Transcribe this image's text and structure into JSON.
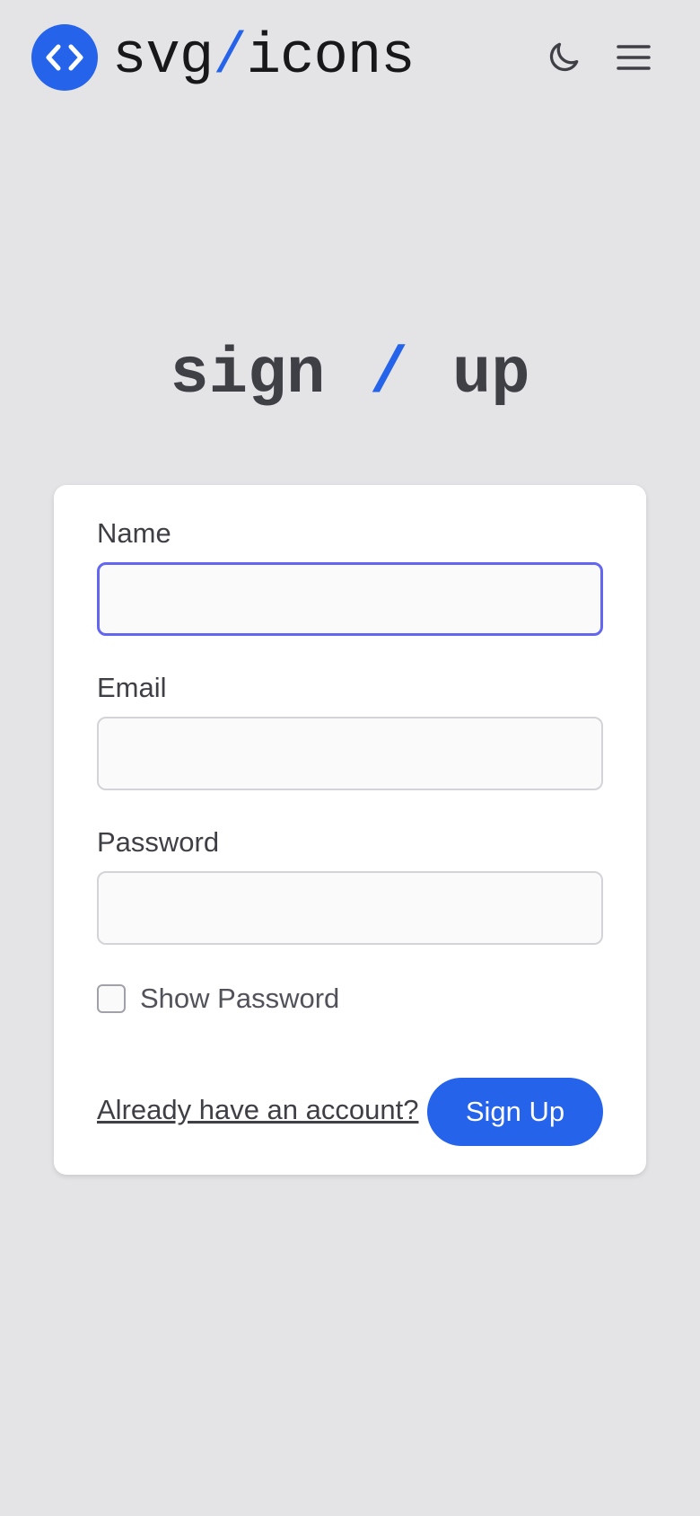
{
  "header": {
    "logo": {
      "left": "svg",
      "slash": "/",
      "right": "icons",
      "icon": "code-brackets-icon"
    },
    "theme_toggle_icon": "moon-icon",
    "menu_icon": "hamburger-menu-icon"
  },
  "title": {
    "left": "sign",
    "slash": "/",
    "right": "up"
  },
  "form": {
    "name": {
      "label": "Name",
      "value": "",
      "placeholder": ""
    },
    "email": {
      "label": "Email",
      "value": "",
      "placeholder": ""
    },
    "password": {
      "label": "Password",
      "value": "",
      "placeholder": ""
    },
    "show_password": {
      "label": "Show Password",
      "checked": false
    },
    "login_link": "Already have an account?",
    "submit_label": "Sign Up"
  },
  "colors": {
    "accent": "#2563eb",
    "background": "#e4e4e7",
    "card": "#ffffff",
    "focus_ring": "#6366f1",
    "text": "#3f3f46"
  }
}
